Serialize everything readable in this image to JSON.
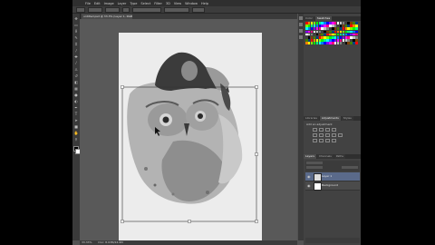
{
  "menubar": {
    "items": [
      "File",
      "Edit",
      "Image",
      "Layer",
      "Type",
      "Select",
      "Filter",
      "3D",
      "View",
      "Window",
      "Help"
    ]
  },
  "document": {
    "tab_title": "untitled.psd @ 33.3% (Layer 1, RGB/8)"
  },
  "status": {
    "zoom": "33.33%",
    "doc_size": "Doc: 8.93M/24.9M"
  },
  "panels": {
    "swatches_tabs": [
      "Color",
      "Swatches"
    ],
    "adjustments_tabs": [
      "Libraries",
      "Adjustments",
      "Styles"
    ],
    "adjustments_title": "Add an adjustment",
    "layers_tabs": [
      "Layers",
      "Channels",
      "Paths"
    ],
    "layers": [
      {
        "name": "Layer 1",
        "selected": true
      },
      {
        "name": "Background",
        "selected": false
      }
    ]
  },
  "colors": {
    "app_bg": "#535353",
    "panel_bg": "#424242",
    "document_bg": "#ececec",
    "selection": "#5a6a8a"
  },
  "icons": {
    "tools": [
      "move-icon",
      "marquee-icon",
      "lasso-icon",
      "quick-select-icon",
      "crop-icon",
      "eyedropper-icon",
      "healing-icon",
      "brush-icon",
      "clone-stamp-icon",
      "history-brush-icon",
      "eraser-icon",
      "gradient-icon",
      "blur-icon",
      "dodge-icon",
      "pen-icon",
      "type-icon",
      "path-select-icon",
      "shape-icon",
      "hand-icon",
      "zoom-icon"
    ]
  }
}
